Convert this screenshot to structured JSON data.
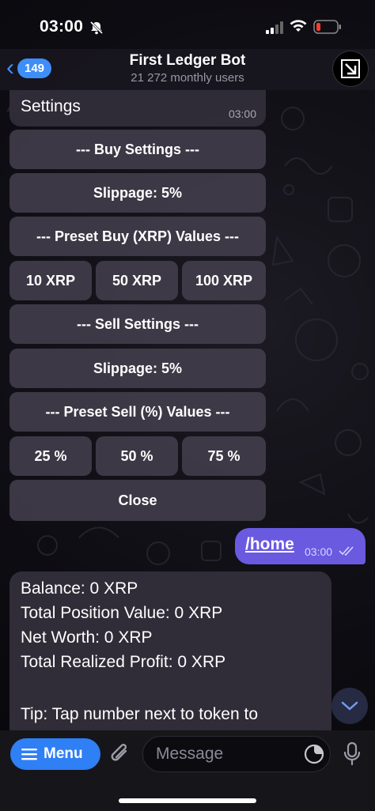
{
  "status_bar": {
    "time": "03:00"
  },
  "header": {
    "unread_count": "149",
    "title": "First Ledger Bot",
    "subtitle": "21 272 monthly users"
  },
  "settings_message": {
    "text": "Settings",
    "time": "03:00",
    "buttons": {
      "buy_header": "--- Buy Settings ---",
      "buy_slippage": "Slippage: 5%",
      "preset_buy_header": "--- Preset Buy (XRP) Values ---",
      "buy_10": "10 XRP",
      "buy_50": "50 XRP",
      "buy_100": "100 XRP",
      "sell_header": "--- Sell Settings ---",
      "sell_slippage": "Slippage: 5%",
      "preset_sell_header": "--- Preset Sell (%) Values ---",
      "sell_25": "25 %",
      "sell_50": "50 %",
      "sell_75": "75 %",
      "close": "Close"
    }
  },
  "outgoing_message": {
    "text": "/home",
    "time": "03:00"
  },
  "balance_message": {
    "lines": [
      "Balance: 0 XRP",
      "Total Position Value: 0 XRP",
      "Net Worth: 0 XRP",
      "Total Realized Profit: 0 XRP",
      "Tip: Tap number next to token to"
    ]
  },
  "composer": {
    "menu_label": "Menu",
    "placeholder": "Message"
  },
  "colors": {
    "accent": "#3e8ef7",
    "outgoing_bubble": "#6a5ae0",
    "keyboard_button": "#44404e"
  },
  "icons": [
    "bell-slash-icon",
    "signal-icon",
    "wifi-icon",
    "battery-icon",
    "back-chevron-icon",
    "paperclip-icon",
    "sticker-icon",
    "microphone-icon",
    "chevron-down-icon",
    "double-check-icon"
  ]
}
